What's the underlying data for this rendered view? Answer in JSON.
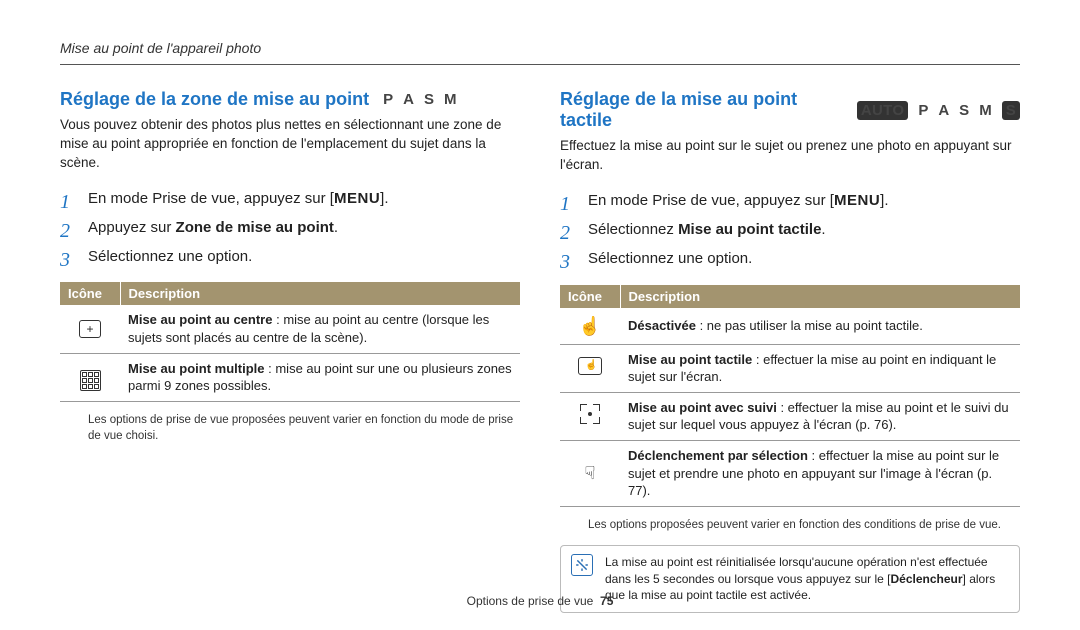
{
  "breadcrumb": "Mise au point de l'appareil photo",
  "footer": {
    "section": "Options de prise de vue",
    "page": "75"
  },
  "left": {
    "heading": "Réglage de la zone de mise au point",
    "modes": [
      "P",
      "A",
      "S",
      "M"
    ],
    "intro": "Vous pouvez obtenir des photos plus nettes en sélectionnant une zone de mise au point appropriée en fonction de l'emplacement du sujet dans la scène.",
    "steps": {
      "s1a": "En mode Prise de vue, appuyez sur [",
      "menu": "MENU",
      "s1b": "].",
      "s2a": "Appuyez sur ",
      "s2bold": "Zone de mise au point",
      "s2b": ".",
      "s3": "Sélectionnez une option."
    },
    "table": {
      "headers": {
        "icon": "Icône",
        "desc": "Description"
      },
      "rows": [
        {
          "icon": "center",
          "bold": "Mise au point au centre",
          "text": " : mise au point au centre (lorsque les sujets sont placés au centre de la scène)."
        },
        {
          "icon": "multi",
          "bold": "Mise au point multiple",
          "text": " : mise au point sur une ou plusieurs zones parmi 9 zones possibles."
        }
      ]
    },
    "footnote": "Les options de prise de vue proposées peuvent varier en fonction du mode de prise de vue choisi."
  },
  "right": {
    "heading": "Réglage de la mise au point tactile",
    "pill_left": "AUTO",
    "pill_right": "S",
    "modes": [
      "P",
      "A",
      "S",
      "M"
    ],
    "intro": "Effectuez la mise au point sur le sujet ou prenez une photo en appuyant sur l'écran.",
    "steps": {
      "s1a": "En mode Prise de vue, appuyez sur [",
      "menu": "MENU",
      "s1b": "].",
      "s2a": "Sélectionnez ",
      "s2bold": "Mise au point tactile",
      "s2b": ".",
      "s3": "Sélectionnez une option."
    },
    "table": {
      "headers": {
        "icon": "Icône",
        "desc": "Description"
      },
      "rows": [
        {
          "icon": "off",
          "bold": "Désactivée",
          "text": " : ne pas utiliser la mise au point tactile."
        },
        {
          "icon": "touch",
          "bold": "Mise au point tactile",
          "text": " : effectuer la mise au point en indiquant le sujet sur l'écran."
        },
        {
          "icon": "track",
          "bold": "Mise au point avec suivi",
          "text": " : effectuer la mise au point et le suivi du sujet sur lequel vous appuyez à l'écran (p. 76)."
        },
        {
          "icon": "shutter",
          "bold": "Déclenchement par sélection",
          "text": " : effectuer la mise au point sur le sujet et prendre une photo en appuyant sur l'image à l'écran (p. 77)."
        }
      ]
    },
    "footnote": "Les options proposées peuvent varier en fonction des conditions de prise de vue.",
    "note": {
      "a": "La mise au point est réinitialisée lorsqu'aucune opération n'est effectuée dans les 5 secondes ou lorsque vous appuyez sur le [",
      "bold": "Déclencheur",
      "b": "] alors que la mise au point tactile est activée."
    }
  }
}
